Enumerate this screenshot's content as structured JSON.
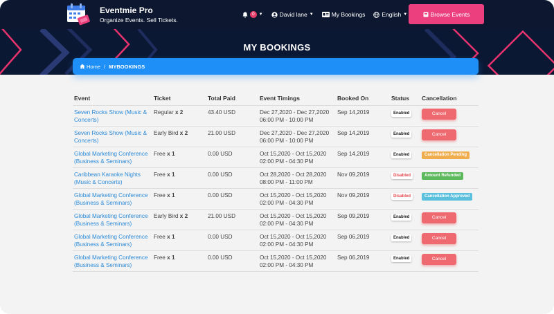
{
  "app": {
    "name": "Eventmie Pro",
    "tagline": "Organize Events. Sell Tickets."
  },
  "nav": {
    "notification_count": "0",
    "user": "David lane",
    "bookings": "My Bookings",
    "language": "English",
    "browse_label": "Browse Events"
  },
  "page": {
    "title": "MY BOOKINGS",
    "breadcrumb_home": "Home",
    "breadcrumb_sep": "/",
    "breadcrumb_current": "MYBOOKINGS"
  },
  "table": {
    "columns": [
      "Event",
      "Ticket",
      "Total Paid",
      "Event Timings",
      "Booked On",
      "Status",
      "Cancellation"
    ],
    "rows": [
      {
        "event": "Seven Rocks Show (Music & Concerts)",
        "ticket": "Regular",
        "qty": "x 2",
        "paid": "43.40 USD",
        "timing": "Dec 27,2020 - Dec 27,2020",
        "hours": "06:00 PM - 10:00 PM",
        "booked": "Sep 14,2019",
        "status": "Enabled",
        "cancellation": "Cancel",
        "cancel_type": "button"
      },
      {
        "event": "Seven Rocks Show (Music & Concerts)",
        "ticket": "Early Bird",
        "qty": "x 2",
        "paid": "21.00 USD",
        "timing": "Dec 27,2020 - Dec 27,2020",
        "hours": "06:00 PM - 10:00 PM",
        "booked": "Sep 14,2019",
        "status": "Enabled",
        "cancellation": "Cancel",
        "cancel_type": "button"
      },
      {
        "event": "Global Marketing Conference (Business & Seminars)",
        "ticket": "Free",
        "qty": "x 1",
        "paid": "0.00 USD",
        "timing": "Oct 15,2020 - Oct 15,2020",
        "hours": "02:00 PM - 04:30 PM",
        "booked": "Sep 14,2019",
        "status": "Enabled",
        "cancellation": "Cancellation Pending",
        "cancel_type": "pending"
      },
      {
        "event": "Caribbean Karaoke Nights (Music & Concerts)",
        "ticket": "Free",
        "qty": "x 1",
        "paid": "0.00 USD",
        "timing": "Oct 28,2020 - Oct 28,2020",
        "hours": "08:00 PM - 11:00 PM",
        "booked": "Nov 09,2019",
        "status": "Disabled",
        "cancellation": "Amount Refunded",
        "cancel_type": "refunded"
      },
      {
        "event": "Global Marketing Conference (Business & Seminars)",
        "ticket": "Free",
        "qty": "x 1",
        "paid": "0.00 USD",
        "timing": "Oct 15,2020 - Oct 15,2020",
        "hours": "02:00 PM - 04:30 PM",
        "booked": "Nov 09,2019",
        "status": "Disabled",
        "cancellation": "Cancellation Approved",
        "cancel_type": "approved"
      },
      {
        "event": "Global Marketing Conference (Business & Seminars)",
        "ticket": "Early Bird",
        "qty": "x 2",
        "paid": "21.00 USD",
        "timing": "Oct 15,2020 - Oct 15,2020",
        "hours": "02:00 PM - 04:30 PM",
        "booked": "Sep 09,2019",
        "status": "Enabled",
        "cancellation": "Cancel",
        "cancel_type": "button"
      },
      {
        "event": "Global Marketing Conference (Business & Seminars)",
        "ticket": "Free",
        "qty": "x 1",
        "paid": "0.00 USD",
        "timing": "Oct 15,2020 - Oct 15,2020",
        "hours": "02:00 PM - 04:30 PM",
        "booked": "Sep 06,2019",
        "status": "Enabled",
        "cancellation": "Cancel",
        "cancel_type": "button"
      },
      {
        "event": "Global Marketing Conference (Business & Seminars)",
        "ticket": "Free",
        "qty": "x 1",
        "paid": "0.00 USD",
        "timing": "Oct 15,2020 - Oct 15,2020",
        "hours": "02:00 PM - 04:30 PM",
        "booked": "Sep 06,2019",
        "status": "Enabled",
        "cancellation": "Cancel",
        "cancel_type": "button"
      }
    ]
  },
  "colors": {
    "header_bg": "#0d1830",
    "accent_pink": "#ec3f7d",
    "breadcrumb_blue": "#1e8ff6",
    "link_blue": "#2b8ad8",
    "cancel_red": "#ee6a70",
    "pending_orange": "#f0ad4e",
    "refunded_green": "#5cb85c",
    "approved_cyan": "#5bc0de"
  },
  "icons": {
    "logo": "calendar-tickets-icon",
    "notifications": "bell-icon",
    "user": "user-circle-icon",
    "bookings": "id-card-icon",
    "language": "globe-icon",
    "browse": "ticket-icon",
    "home": "home-icon"
  }
}
